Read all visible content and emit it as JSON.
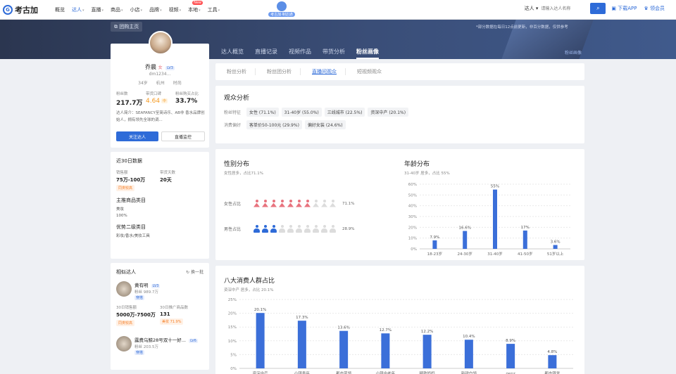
{
  "header": {
    "logo_text": "考古加",
    "logo_mark": "G",
    "nav": [
      {
        "label": "概览",
        "caret": false
      },
      {
        "label": "达人",
        "caret": true,
        "active": true
      },
      {
        "label": "直播",
        "caret": true
      },
      {
        "label": "商品",
        "caret": true
      },
      {
        "label": "小店",
        "caret": true
      },
      {
        "label": "品牌",
        "caret": true
      },
      {
        "label": "视频",
        "caret": true
      },
      {
        "label": "本地",
        "caret": true,
        "badge": "New"
      },
      {
        "label": "工具",
        "caret": true
      }
    ],
    "promo_label": "考古加·制达通",
    "search_category": "达人 ▾",
    "search_placeholder": "请输入达人名称",
    "search_icon": "search-icon",
    "download_label": "下载APP",
    "vip_label": "领会员"
  },
  "banner": {
    "group_home": "团购主页",
    "note": "*部分数据在每日12点前更新，非百分数据，仅供参考",
    "tabs": [
      "达人概览",
      "直播记录",
      "视频作品",
      "带货分析",
      "粉丝画像"
    ],
    "active_tab": 4,
    "link": "粉丝画像"
  },
  "profile": {
    "name": "乔晨",
    "gender_icon": "女",
    "level": "LV3",
    "id": "dm1234...",
    "tags": [
      "34岁",
      "杭州",
      "时尚"
    ],
    "stats": [
      {
        "label": "粉丝数",
        "value": "217.7万"
      },
      {
        "label": "带货口碑",
        "value": "4.64",
        "rating": "中"
      },
      {
        "label": "粉丝购买占比",
        "value": "33.7%"
      }
    ],
    "intro": "达人简介：SEAFANCY至简诗乐、AB非 香水品牌创始人，拥有领先全球的调...",
    "follow_button": "关注达人",
    "monitor_button": "直播监控"
  },
  "recent": {
    "title": "近30日数据",
    "sales_label": "销售额",
    "sales_value": "75万-100万",
    "sales_tag": "同类较高",
    "days_label": "带货天数",
    "days_value": "20天",
    "main_category_title": "主推商品类目",
    "main_category": "美妆",
    "main_category_pct": "100%",
    "second_title": "优势二级类目",
    "second_value": "彩妆/香水/美妆工具"
  },
  "similar": {
    "title": "相似达人",
    "refresh": "换一批",
    "item1": {
      "name": "黄有明",
      "level": "LV3",
      "fans": "粉丝 989.7万",
      "tag": "穿搭",
      "stat1_label": "30日销售额",
      "stat1_value": "5000万-7500万",
      "stat1_tag": "同类较高",
      "stat2_label": "30日推广商品数",
      "stat2_value": "131",
      "stat2_tag": "美妆 71.9%"
    },
    "item2": {
      "name": "露费乌鲸28号双十一好...",
      "level": "LV6",
      "fans": "粉丝 203.5万",
      "tag": "穿搭"
    }
  },
  "subtabs": [
    "粉丝分析",
    "粉丝团分析",
    "直播间观众",
    "短视频观众"
  ],
  "active_subtab": 2,
  "audience": {
    "title": "观众分析",
    "label": "粉丝特征",
    "chips": [
      "女性 (71.1%)",
      "31-40岁 (55.0%)",
      "三线城市 (22.5%)",
      "资深中产 (20.1%)"
    ],
    "label2": "消费偏好",
    "chips2": [
      "客单价50-100元 (29.9%)",
      "偏好女装 (24.6%)"
    ]
  },
  "gender": {
    "title": "性别分布",
    "subtitle": "女性居多，占比71.1%",
    "female_label": "女性占比",
    "female_pct": "71.1%",
    "female_filled": 7,
    "male_label": "男性占比",
    "male_pct": "28.9%",
    "male_filled": 3,
    "female_color": "#e8737e",
    "male_color": "#2e6bd8",
    "empty_color": "#dcdcdc"
  },
  "chart_data": [
    {
      "type": "bar",
      "title": "年龄分布",
      "subtitle": "31-40岁 居多，占比 55%",
      "categories": [
        "18-23岁",
        "24-30岁",
        "31-40岁",
        "41-50岁",
        "51岁以上"
      ],
      "values": [
        7.9,
        16.6,
        55,
        17,
        3.6
      ],
      "labels": [
        "7.9%",
        "16.6%",
        "55%",
        "17%",
        "3.6%"
      ],
      "yticks": [
        "0%",
        "10%",
        "20%",
        "30%",
        "40%",
        "50%",
        "60%"
      ],
      "ylim": [
        0,
        60
      ],
      "color": "#3b6fd9",
      "grid": true
    },
    {
      "type": "bar",
      "title": "八大消费人群占比",
      "subtitle": "资深中产 居多，占比 20.1%",
      "categories": [
        "资深中产",
        "小镇青年",
        "都市蓝领",
        "小镇中老年",
        "精致妈妈",
        "新锐白领",
        "genz",
        "都市银发"
      ],
      "values": [
        20.1,
        17.3,
        13.6,
        12.7,
        12.2,
        10.4,
        8.9,
        4.8
      ],
      "labels": [
        "20.1%",
        "17.3%",
        "13.6%",
        "12.7%",
        "12.2%",
        "10.4%",
        "8.9%",
        "4.8%"
      ],
      "yticks": [
        "0%",
        "5%",
        "10%",
        "15%",
        "20%",
        "25%"
      ],
      "ylim": [
        0,
        25
      ],
      "color": "#3b6fd9",
      "grid": true
    }
  ]
}
